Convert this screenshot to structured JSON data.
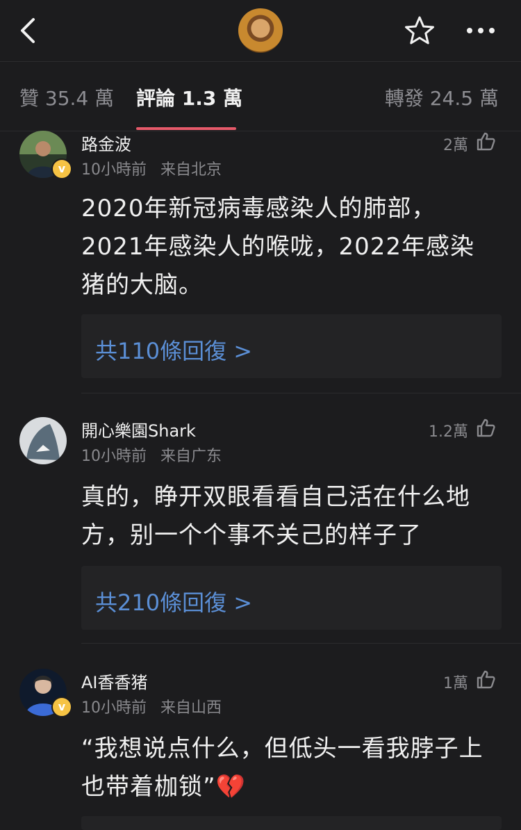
{
  "topbar": {
    "back_icon": "chevron-left-icon",
    "star_icon": "star-outline-icon",
    "more_icon": "more-horizontal-icon"
  },
  "tabs": {
    "likes": "贊 35.4 萬",
    "comments": "評論 1.3 萬",
    "reposts": "轉發 24.5 萬",
    "active_color": "#e65a6a"
  },
  "comments": [
    {
      "name": "路金波",
      "time": "10小時前",
      "location": "来自北京",
      "likes": "2萬",
      "text": "2020年新冠病毒感染人的肺部，2021年感染人的喉咙，2022年感染猪的大脑。",
      "replies": "共110條回復 >",
      "verified": true
    },
    {
      "name": "開心樂園Shark",
      "time": "10小時前",
      "location": "来自广东",
      "likes": "1.2萬",
      "text": "真的，睁开双眼看看自己活在什么地方，别一个个事不关己的样子了",
      "replies": "共210條回復 >",
      "verified": false
    },
    {
      "name": "AI香香猪",
      "time": "10小時前",
      "location": "来自山西",
      "likes": "1萬",
      "text": "“我想说点什么，但低头一看我脖子上也带着枷锁”💔",
      "verified": true
    }
  ],
  "colors": {
    "background": "#1c1c1e",
    "link": "#5b8fd6",
    "verified_badge": "#f6c344"
  }
}
